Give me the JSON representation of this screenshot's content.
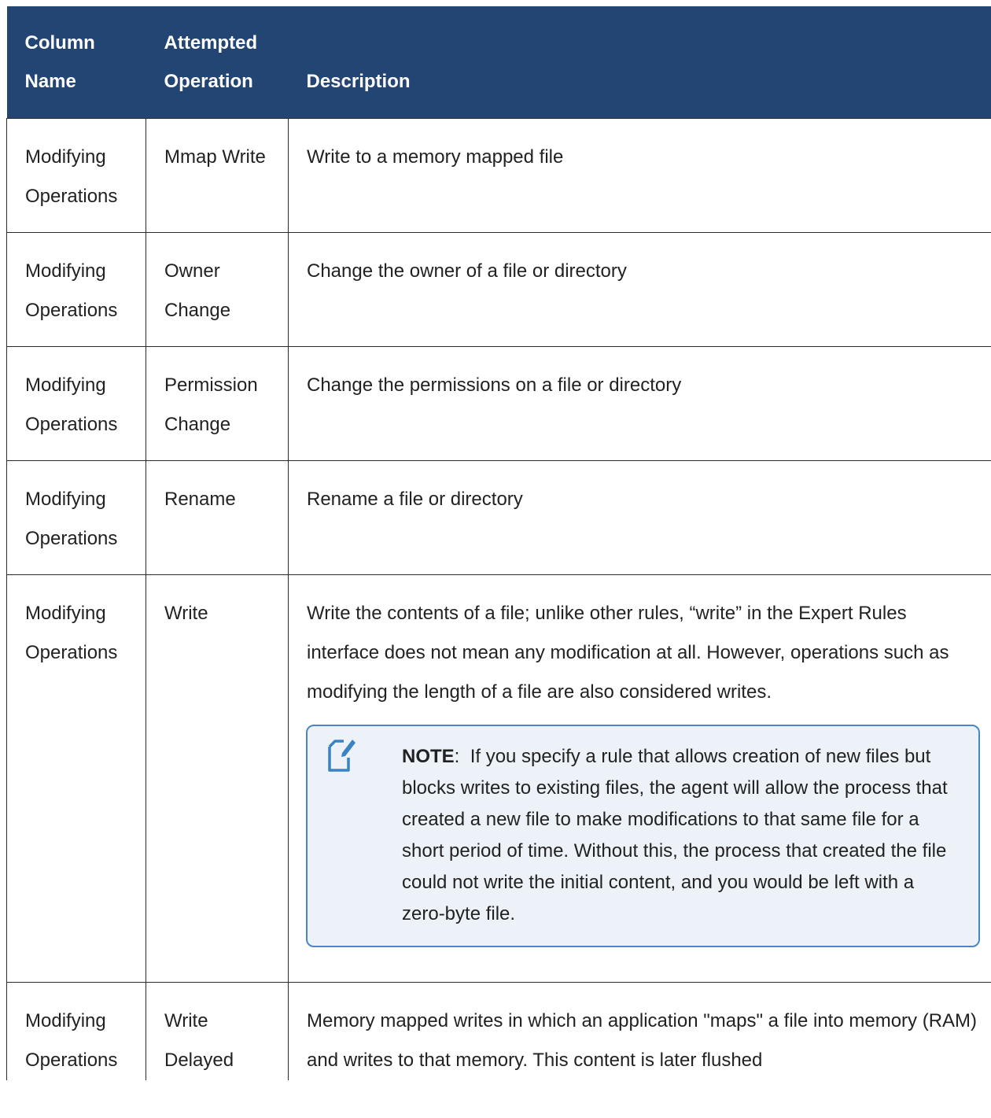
{
  "header": {
    "col1": "Column Name",
    "col2": "Attempted Operation",
    "col3": "Description"
  },
  "rows": [
    {
      "column": "Modifying Operations",
      "operation": "Mmap Write",
      "description": "Write to a memory mapped file"
    },
    {
      "column": "Modifying Operations",
      "operation": "Owner Change",
      "description": "Change the owner of a file or directory"
    },
    {
      "column": "Modifying Operations",
      "operation": "Permission Change",
      "description": "Change the permissions on a file or directory"
    },
    {
      "column": "Modifying Operations",
      "operation": "Rename",
      "description": "Rename a file or directory"
    },
    {
      "column": "Modifying Operations",
      "operation": "Write",
      "description": "Write the contents of a file; unlike other rules, “write” in the Expert Rules interface does not mean any modification at all. However, operations such as modifying the length of a file are also considered writes."
    },
    {
      "column": "Modifying Operations",
      "operation": "Write Delayed",
      "description": "Memory mapped writes in which an application \"maps\" a file into memory (RAM) and writes to that memory. This content is later flushed"
    }
  ],
  "note": {
    "icon": "note-edit-icon",
    "label": "NOTE",
    "separator": ":",
    "text": "If you specify a rule that allows creation of new files but blocks writes to existing files, the agent will allow the process that created a new file to make modifications to that same file for a short period of time. Without this, the process that created the file could not write the initial content, and you would be left with a zero-byte file."
  },
  "colors": {
    "header_bg": "#234574",
    "note_border": "#4a86c5",
    "note_bg": "#ecf2f8"
  }
}
